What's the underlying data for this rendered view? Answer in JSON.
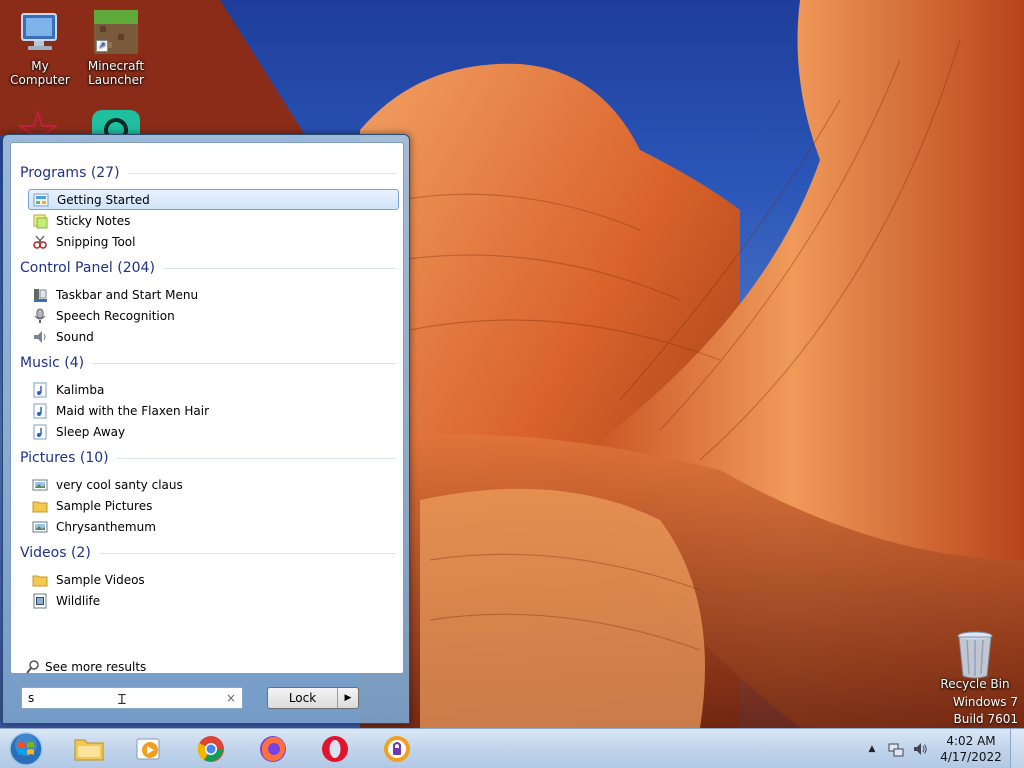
{
  "desktop": {
    "icons": [
      {
        "label_line1": "My Computer",
        "label_line2": ""
      },
      {
        "label_line1": "Minecraft",
        "label_line2": "Launcher"
      },
      {
        "label_line1": "Recycle Bin",
        "label_line2": ""
      }
    ]
  },
  "start_menu": {
    "categories": [
      {
        "title": "Programs (27)",
        "items": [
          "Getting Started",
          "Sticky Notes",
          "Snipping Tool"
        ]
      },
      {
        "title": "Control Panel (204)",
        "items": [
          "Taskbar and Start Menu",
          "Speech Recognition",
          "Sound"
        ]
      },
      {
        "title": "Music (4)",
        "items": [
          "Kalimba",
          "Maid with the Flaxen Hair",
          "Sleep Away"
        ]
      },
      {
        "title": "Pictures (10)",
        "items": [
          "very cool santy claus",
          "Sample Pictures",
          "Chrysanthemum"
        ]
      },
      {
        "title": "Videos (2)",
        "items": [
          "Sample Videos",
          "Wildlife"
        ]
      }
    ],
    "see_more": "See more results",
    "search": {
      "value": "s",
      "clear": "×"
    },
    "lock": {
      "label": "Lock",
      "arrow": "▶"
    }
  },
  "watermark": {
    "line1": "Windows 7",
    "line2": "Build 7601"
  },
  "taskbar": {
    "clock": {
      "time": "4:02 AM",
      "date": "4/17/2022"
    },
    "tray": {
      "expand": "▲"
    }
  },
  "colors": {
    "accent": "#1e3287",
    "selection": "#cfe4fa",
    "taskbar": "#c3d6ec"
  }
}
